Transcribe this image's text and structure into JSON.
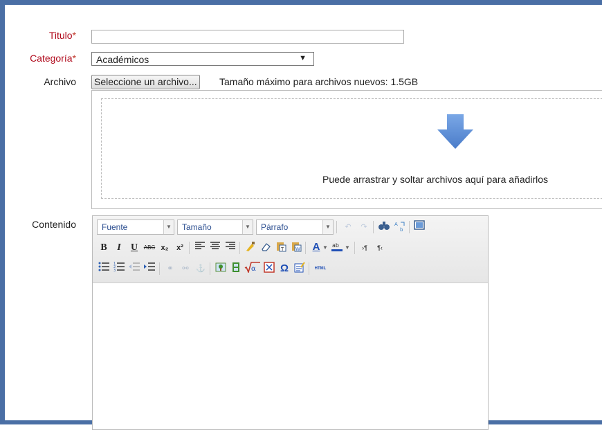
{
  "form": {
    "title_label": "Titulo",
    "category_label": "Categoría",
    "required_mark": "*",
    "category_selected": "Académicos",
    "file_label": "Archivo",
    "file_button": "Seleccione un archivo...",
    "max_size_text": "Tamaño máximo para archivos nuevos: 1.5GB",
    "drop_hint": "Puede arrastrar y soltar archivos aquí para añadirlos",
    "content_label": "Contenido"
  },
  "editor": {
    "font_select": "Fuente",
    "size_select": "Tamaño",
    "format_select": "Párrafo",
    "buttons": {
      "bold": "B",
      "italic": "I",
      "underline": "U",
      "strike": "ABC",
      "subscript": "x₂",
      "superscript": "x²",
      "html": "HTML",
      "omega": "Ω",
      "text_color": "A",
      "ltr": "›¶",
      "rtl": "¶‹"
    }
  },
  "colors": {
    "frame": "#4a6fa5",
    "required": "#b0091b",
    "arrow": "#5b8fd6"
  }
}
